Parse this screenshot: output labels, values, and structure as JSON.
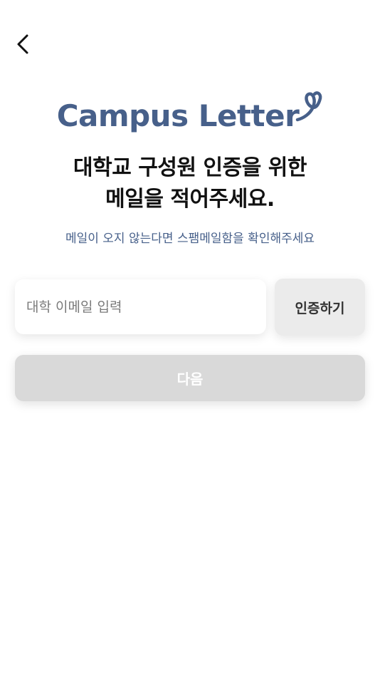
{
  "header": {
    "back_icon": "chevron-left-icon"
  },
  "logo": {
    "text": "Campus Letter",
    "color": "#47608a"
  },
  "title": {
    "line1": "대학교 구성원 인증을 위한",
    "line2": "메일을 적어주세요."
  },
  "subtitle": "메일이 오지 않는다면 스팸메일함을 확인해주세요",
  "email_input": {
    "value": "",
    "placeholder": "대학 이메일 입력"
  },
  "verify_button": {
    "label": "인증하기"
  },
  "next_button": {
    "label": "다음"
  },
  "colors": {
    "brand": "#47608a",
    "button_disabled": "#d9d9d9",
    "verify_bg": "#ebebeb"
  }
}
